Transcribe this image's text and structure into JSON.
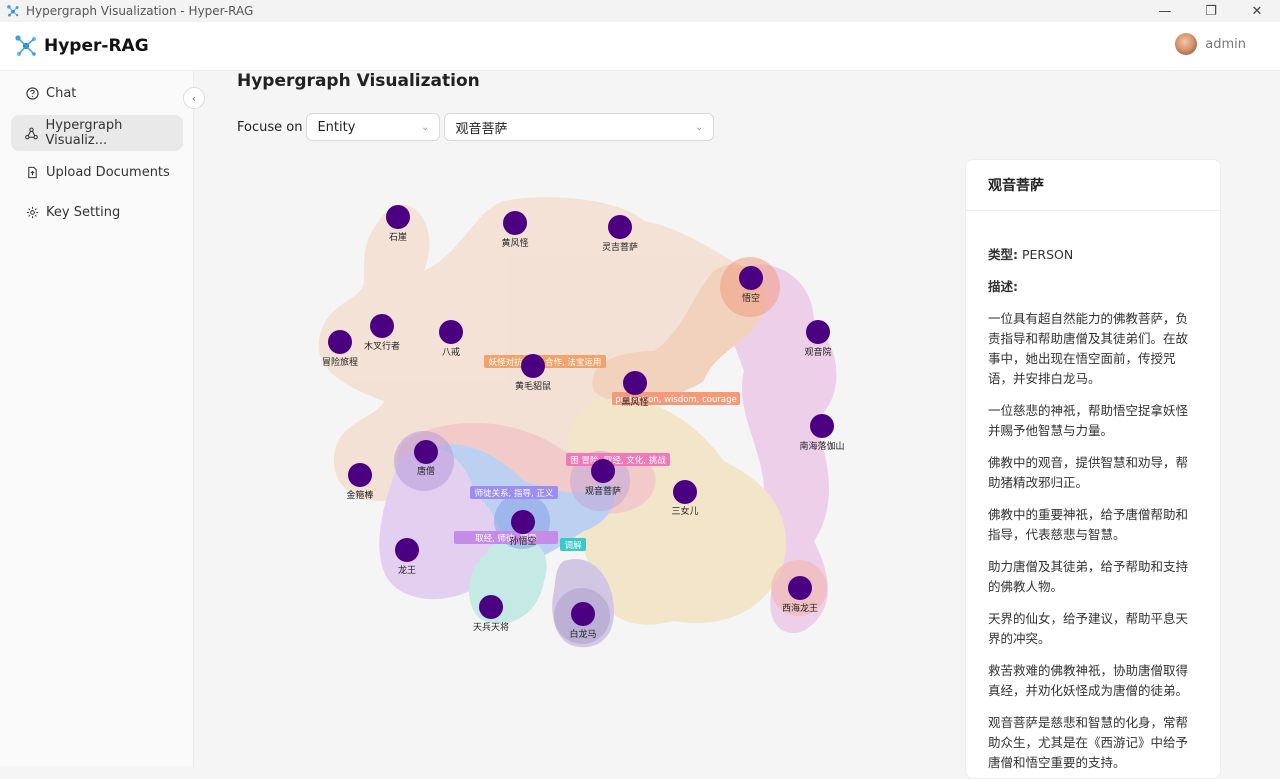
{
  "window": {
    "title": "Hypergraph Visualization - Hyper-RAG"
  },
  "app": {
    "name": "Hyper-RAG"
  },
  "user": {
    "name": "admin"
  },
  "sidebar": {
    "items": [
      {
        "label": "Chat",
        "icon": "help-circle-icon"
      },
      {
        "label": "Hypergraph Visualiz...",
        "icon": "hypergraph-icon",
        "active": true
      },
      {
        "label": "Upload Documents",
        "icon": "upload-file-icon"
      },
      {
        "label": "Key Setting",
        "icon": "gear-icon"
      }
    ]
  },
  "page": {
    "title": "Hypergraph Visualization"
  },
  "focus": {
    "label": "Focuse on",
    "type_value": "Entity",
    "entity_value": "观音菩萨"
  },
  "graph": {
    "nodes": [
      {
        "id": "shiya",
        "label": "石崖"
      },
      {
        "id": "huangfengguai",
        "label": "黄风怪"
      },
      {
        "id": "lingji",
        "label": "灵吉菩萨"
      },
      {
        "id": "wukong",
        "label": "悟空"
      },
      {
        "id": "guanyinyuan",
        "label": "观音院"
      },
      {
        "id": "maoxian",
        "label": "冒险旅程"
      },
      {
        "id": "mucha",
        "label": "木叉行者"
      },
      {
        "id": "bajie",
        "label": "八戒"
      },
      {
        "id": "huangmao",
        "label": "黄毛貂鼠"
      },
      {
        "id": "heifeng",
        "label": "黑风怪"
      },
      {
        "id": "nanhai",
        "label": "南海落伽山"
      },
      {
        "id": "tangseng",
        "label": "唐僧"
      },
      {
        "id": "guanyin",
        "label": "观音菩萨"
      },
      {
        "id": "jingubang",
        "label": "金箍棒"
      },
      {
        "id": "sannv",
        "label": "三女儿"
      },
      {
        "id": "sunwukong",
        "label": "孙悟空"
      },
      {
        "id": "longwang",
        "label": "龙王"
      },
      {
        "id": "tianbing",
        "label": "天兵天将"
      },
      {
        "id": "bailongma",
        "label": "白龙马"
      },
      {
        "id": "xihai",
        "label": "西海龙王"
      }
    ],
    "edge_tags": [
      {
        "text": "妖怪对抗, 团队合作, 法宝运用",
        "color": "#f0a36a"
      },
      {
        "text": "protection, wisdom, courage",
        "color": "#f29a7a"
      },
      {
        "text": "困 冒险, 取经, 文化, 挑战",
        "color": "#f07ab8"
      },
      {
        "text": "师徒关系, 指导, 正义",
        "color": "#9b8ef0"
      },
      {
        "text": "取经, 师徒, 顺导",
        "color": "#c58be8"
      },
      {
        "text": "调解",
        "color": "#3ac9c9"
      }
    ]
  },
  "detail": {
    "title": "观音菩萨",
    "type_label": "类型:",
    "type_value": "PERSON",
    "desc_label": "描述:",
    "descriptions": [
      "一位具有超自然能力的佛教菩萨，负责指导和帮助唐僧及其徒弟们。在故事中，她出现在悟空面前，传授咒语，并安排白龙马。",
      "一位慈悲的神祇，帮助悟空捉拿妖怪并赐予他智慧与力量。",
      "佛教中的观音，提供智慧和劝导，帮助猪精改邪归正。",
      "佛教中的重要神祇，给予唐僧帮助和指导，代表慈悲与智慧。",
      "助力唐僧及其徒弟，给予帮助和支持的佛教人物。",
      "天界的仙女，给予建议，帮助平息天界的冲突。",
      "救苦救难的佛教神祇，协助唐僧取得真经，并劝化妖怪成为唐僧的徒弟。",
      "观音菩萨是慈悲和智慧的化身，常帮助众生，尤其是在《西游记》中给予唐僧和悟空重要的支持。"
    ]
  },
  "colors": {
    "node": "#4b0082",
    "accent": "#1677ff"
  }
}
